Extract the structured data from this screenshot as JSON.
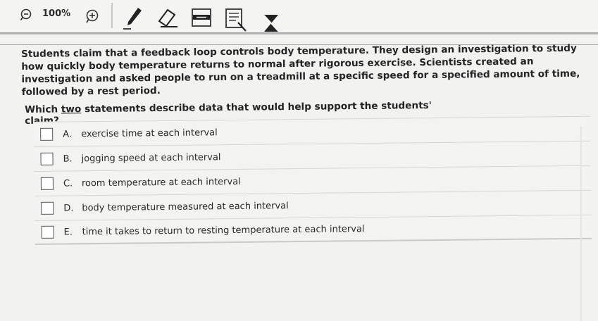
{
  "toolbar": {
    "zoom_level": "100%",
    "tools": [
      "zoom-out",
      "zoom-in",
      "pen",
      "eraser",
      "line-reader",
      "highlighter",
      "answer-masking"
    ]
  },
  "stem": "Students claim that a feedback loop controls body temperature. They design an investigation to study how quickly body temperature returns to normal after rigorous exercise. Scientists created an investigation and asked people to run on a treadmill at a specific speed for a specified amount of time, followed by a rest period.",
  "question": {
    "before": "Which ",
    "underlined": "two",
    "after": " statements describe data that would help support the students' claim?"
  },
  "options": [
    {
      "letter": "A.",
      "text": "exercise time at each interval",
      "checked": false
    },
    {
      "letter": "B.",
      "text": "jogging speed at each interval",
      "checked": false
    },
    {
      "letter": "C.",
      "text": "room temperature at each interval",
      "checked": false
    },
    {
      "letter": "D.",
      "text": "body temperature measured at each interval",
      "checked": false
    },
    {
      "letter": "E.",
      "text": "time it takes to return to resting temperature at each interval",
      "checked": false
    }
  ]
}
